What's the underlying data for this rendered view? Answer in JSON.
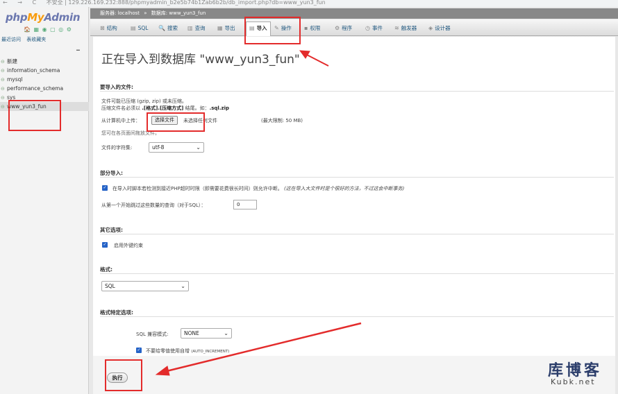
{
  "browser": {
    "address": "不安全 | 129.226.169.232:888/phpmyadmin_b2e5b74b1Zab6b2b/db_import.php?db=www_yun3_fun"
  },
  "logo": {
    "php": "php",
    "my": "My",
    "admin": "Admin",
    "icons": "🏠 ▦ ◉ ▢ ◎ ⚙"
  },
  "nav": {
    "links": [
      "最近访问",
      "表收藏夹"
    ],
    "collapse": "━",
    "databases": [
      {
        "name": "新建",
        "active": false
      },
      {
        "name": "information_schema",
        "active": false
      },
      {
        "name": "mysql",
        "active": false
      },
      {
        "name": "performance_schema",
        "active": false
      },
      {
        "name": "sys",
        "active": false
      },
      {
        "name": "www_yun3_fun",
        "active": true
      }
    ]
  },
  "breadcrumb": {
    "server": "服务器: localhost",
    "sep": "»",
    "db": "数据库: www_yun3_fun"
  },
  "tabs": [
    {
      "icon": "⊠",
      "label": "结构"
    },
    {
      "icon": "▤",
      "label": "SQL"
    },
    {
      "icon": "🔍",
      "label": "搜索"
    },
    {
      "icon": "▥",
      "label": "查询"
    },
    {
      "icon": "▦",
      "label": "导出"
    },
    {
      "icon": "▤",
      "label": "导入"
    },
    {
      "icon": "✎",
      "label": "操作"
    },
    {
      "icon": "▪",
      "label": "权限"
    },
    {
      "icon": "⚙",
      "label": "程序"
    },
    {
      "icon": "◷",
      "label": "事件"
    },
    {
      "icon": "≋",
      "label": "触发器"
    },
    {
      "icon": "◈",
      "label": "设计器"
    }
  ],
  "page": {
    "title": "正在导入到数据库 \"www_yun3_fun\"",
    "file_section": {
      "title": "要导入的文件:",
      "line1": "文件可能已压缩 (gzip, zip) 或未压缩。",
      "line2_pre": "压缩文件名必须以 ",
      "line2_bold": ".[格式].[压缩方式]",
      "line2_mid": " 结尾。如：",
      "line2_ex": ".sql.zip",
      "upload_label": "从计算机中上传：",
      "choose_button": "选择文件",
      "no_file": "未选择任何文件",
      "max_limit": "(最大限制: 50 MB)",
      "drag_hint": "您可在各页面间拖放文件。",
      "charset_label": "文件的字符集:",
      "charset_value": "utf-8"
    },
    "partial_section": {
      "title": "部分导入:",
      "interrupt_text": "在导入时脚本若检测到接近PHP超时时限（即需要花费很长时间）则允许中断。",
      "interrupt_note": "(这在导入大文件时是个很好的方法，不过这会中断事务)",
      "skip_label": "从第一个开始跳过这些数量的查询（对于SQL）：",
      "skip_value": "0"
    },
    "other_section": {
      "title": "其它选项:",
      "fk_label": "启用外键约束"
    },
    "format_section": {
      "title": "格式:",
      "format_value": "SQL"
    },
    "format_specific": {
      "title": "格式特定选项:",
      "compat_label": "SQL 兼容模式:",
      "compat_value": "NONE",
      "no_auto_label": "不要给零值使用自增",
      "no_auto_code": "(AUTO_INCREMENT)"
    },
    "execute_button": "执行"
  },
  "watermark": {
    "title": "库博客",
    "url": "Kubk.net"
  },
  "colors": {
    "annotation": "#e32b2b",
    "checkbox": "#2563c7"
  }
}
